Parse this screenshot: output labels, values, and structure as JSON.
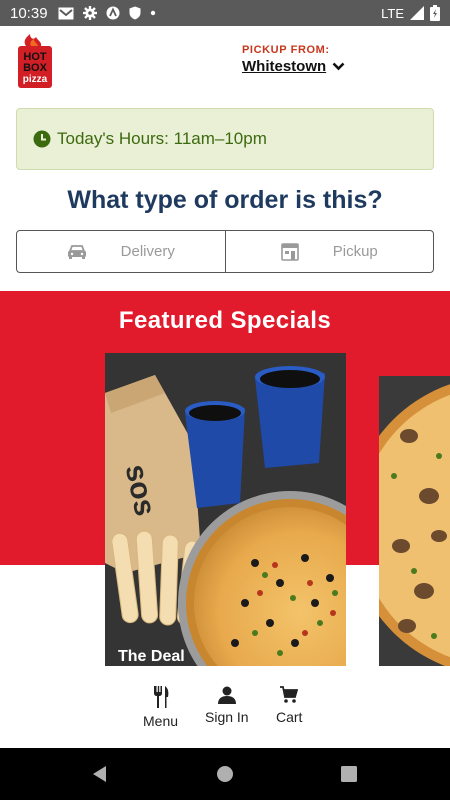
{
  "status_bar": {
    "time": "10:39",
    "network": "LTE",
    "icons": [
      "gmail-icon",
      "settings-icon",
      "vpn-icon",
      "shield-icon",
      "dot-icon"
    ]
  },
  "header": {
    "logo_text": "HOT BOX pizza",
    "pickup_label": "PICKUP FROM:",
    "location": "Whitestown"
  },
  "hours": {
    "text": "Today's Hours: 11am–10pm",
    "icon": "clock-icon",
    "color": "#3d6a0f"
  },
  "order": {
    "title": "What type of order is this?",
    "options": [
      {
        "label": "Delivery",
        "icon": "car-icon"
      },
      {
        "label": "Pickup",
        "icon": "store-icon"
      }
    ]
  },
  "featured": {
    "title": "Featured Specials",
    "brand_color": "#e11b2b",
    "cards": [
      {
        "label": "The Deal"
      },
      {
        "label": ""
      }
    ]
  },
  "bottom_nav": {
    "items": [
      {
        "label": "Menu",
        "icon": "fork-knife-icon"
      },
      {
        "label": "Sign In",
        "icon": "person-icon"
      },
      {
        "label": "Cart",
        "icon": "cart-icon"
      }
    ]
  },
  "system_nav": [
    "back-icon",
    "home-icon",
    "recents-icon"
  ]
}
